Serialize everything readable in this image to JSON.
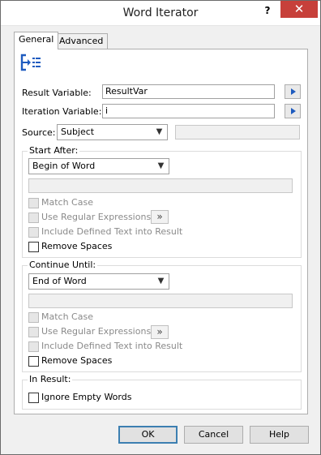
{
  "window": {
    "title": "Word Iterator",
    "help_glyph": "?",
    "close_glyph": "✕"
  },
  "tabs": [
    {
      "label": "General",
      "active": true
    },
    {
      "label": "Advanced",
      "active": false
    }
  ],
  "icon": {
    "name": "iterator-icon",
    "color": "#1e5bbf"
  },
  "fields": {
    "result_variable": {
      "label": "Result Variable:",
      "value": "ResultVar"
    },
    "iteration_variable": {
      "label": "Iteration Variable:",
      "value": "i"
    },
    "source": {
      "label": "Source:",
      "selected": "Subject",
      "text_value": ""
    }
  },
  "start_after": {
    "title": "Start After:",
    "selected": "Begin of Word",
    "text_value": "",
    "match_case": "Match Case",
    "use_regex": "Use Regular Expressions",
    "include_text": "Include Defined Text into Result",
    "remove_spaces": "Remove Spaces",
    "regex_button": "»"
  },
  "continue_until": {
    "title": "Continue Until:",
    "selected": "End of Word",
    "text_value": "",
    "match_case": "Match Case",
    "use_regex": "Use Regular Expressions",
    "include_text": "Include Defined Text into Result",
    "remove_spaces": "Remove Spaces",
    "regex_button": "»"
  },
  "in_result": {
    "title": "In Result:",
    "ignore_empty": "Ignore Empty Words"
  },
  "buttons": {
    "ok": "OK",
    "cancel": "Cancel",
    "help": "Help"
  },
  "dropdown_glyph": "▼"
}
